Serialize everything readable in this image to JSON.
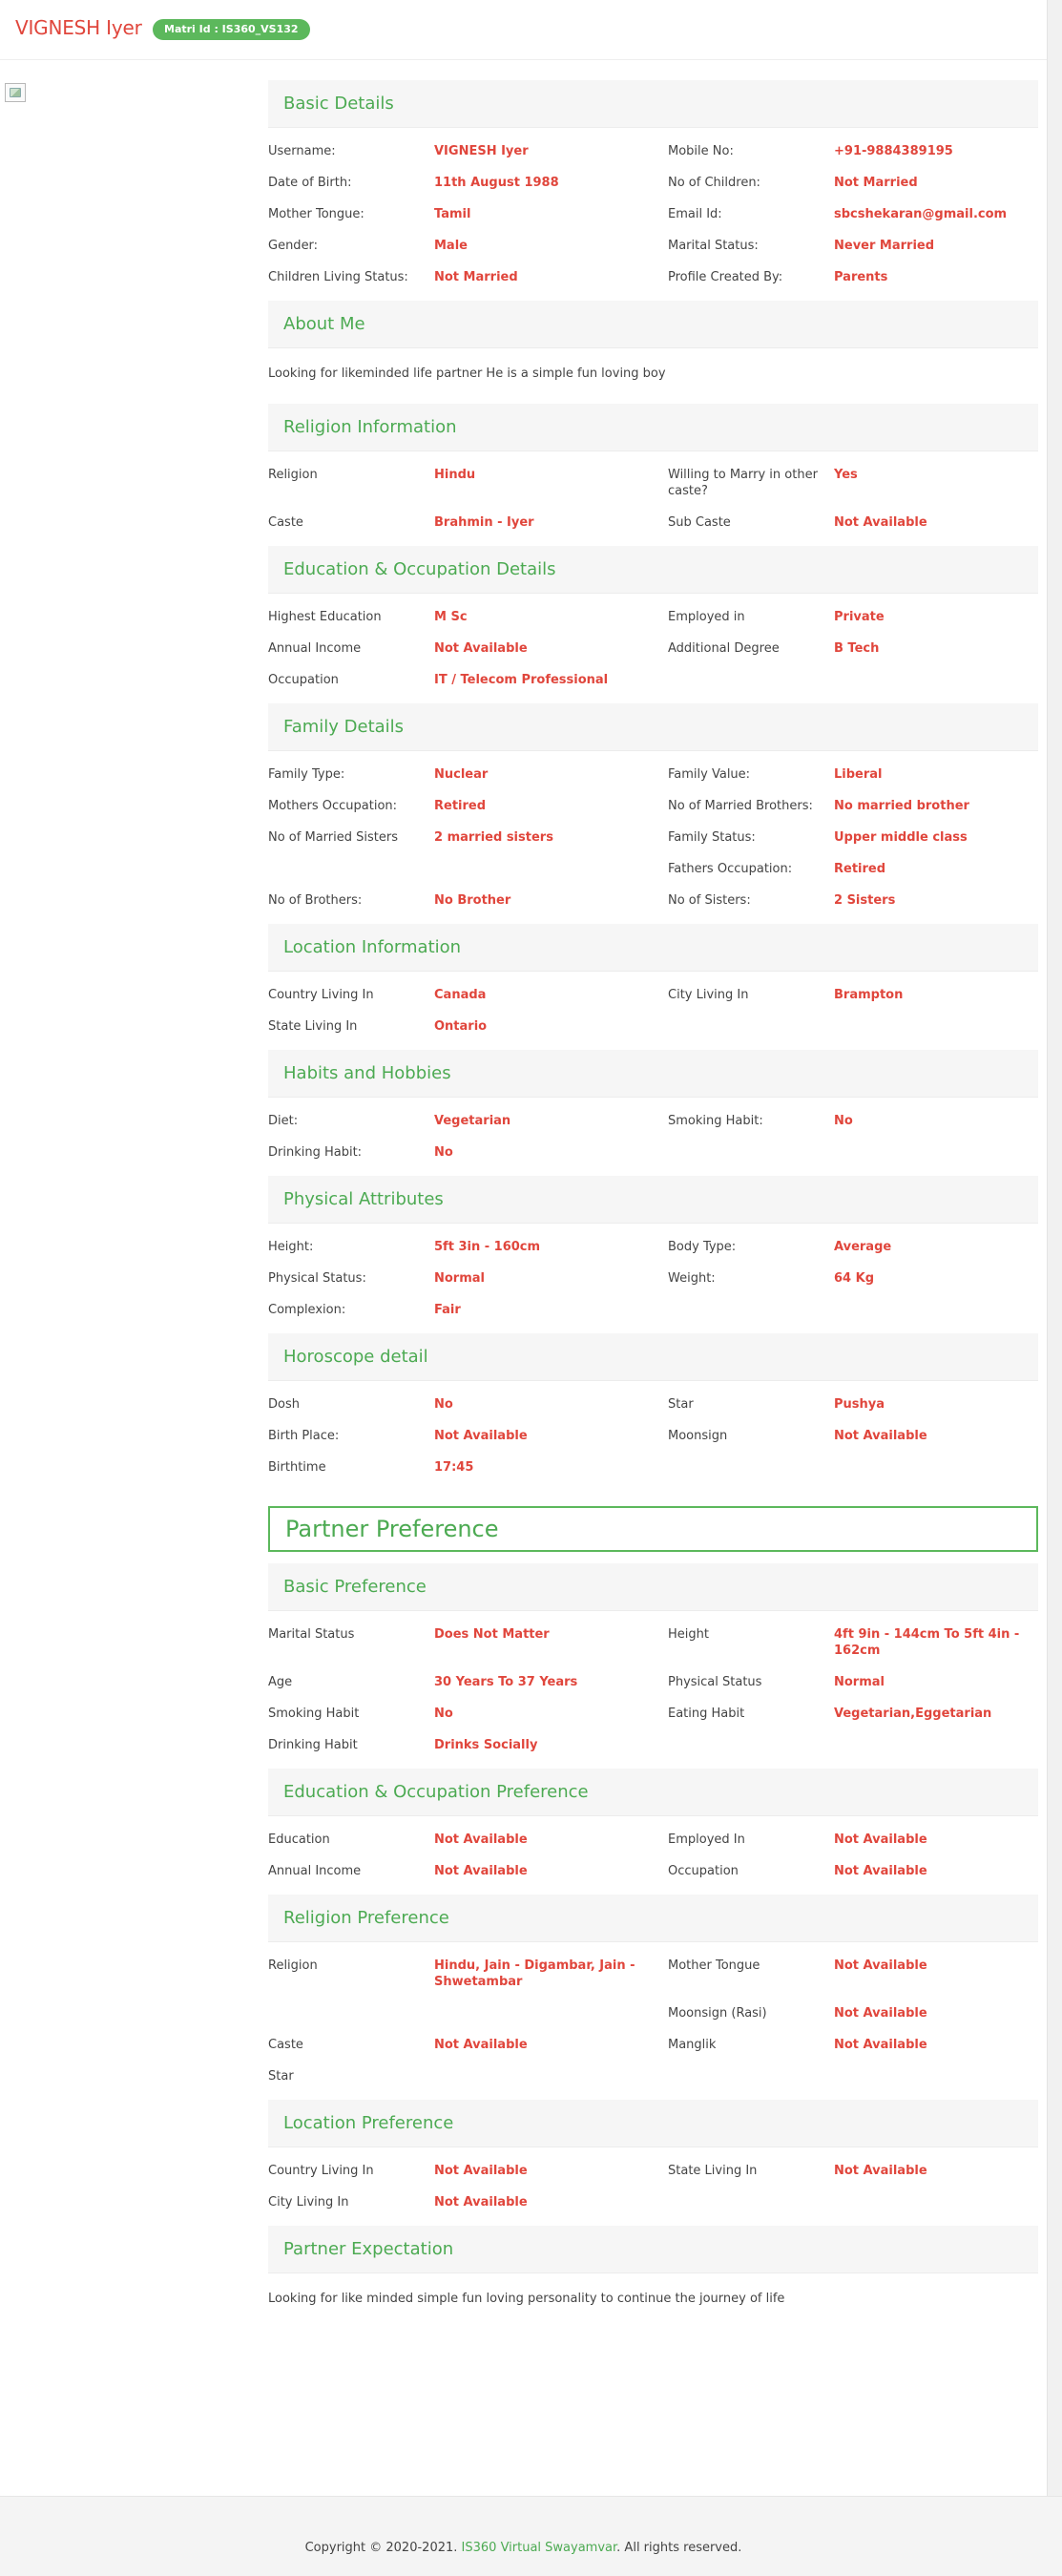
{
  "header": {
    "name": "VIGNESH Iyer",
    "matri_id": "Matri Id : IS360_VS132"
  },
  "basic_details": {
    "title": "Basic Details",
    "rows": [
      [
        {
          "label": "Username:",
          "value": "VIGNESH Iyer"
        },
        {
          "label": "Mobile No:",
          "value": "+91-9884389195"
        }
      ],
      [
        {
          "label": "Date of Birth:",
          "value": "11th August 1988"
        },
        {
          "label": "No of Children:",
          "value": "Not Married"
        }
      ],
      [
        {
          "label": "Mother Tongue:",
          "value": "Tamil"
        },
        {
          "label": "Email Id:",
          "value": "sbcshekaran@gmail.com"
        }
      ],
      [
        {
          "label": "Gender:",
          "value": "Male"
        },
        {
          "label": "Marital Status:",
          "value": "Never Married"
        }
      ],
      [
        {
          "label": "Children Living Status:",
          "value": "Not Married"
        },
        {
          "label": "Profile Created By:",
          "value": "Parents"
        }
      ]
    ]
  },
  "about_me": {
    "title": "About Me",
    "text": "Looking for likeminded life partner He is a simple fun loving boy"
  },
  "religion_info": {
    "title": "Religion Information",
    "rows": [
      [
        {
          "label": "Religion",
          "value": "Hindu"
        },
        {
          "label": "Willing to Marry in other caste?",
          "value": "Yes"
        }
      ],
      [
        {
          "label": "Caste",
          "value": "Brahmin - Iyer"
        },
        {
          "label": "Sub Caste",
          "value": "Not Available"
        }
      ]
    ]
  },
  "education": {
    "title": "Education & Occupation Details",
    "rows": [
      [
        {
          "label": "Highest Education",
          "value": "M Sc"
        },
        {
          "label": "Employed in",
          "value": "Private"
        }
      ],
      [
        {
          "label": "Annual Income",
          "value": "Not Available"
        },
        {
          "label": "Additional Degree",
          "value": "B Tech"
        }
      ],
      [
        {
          "label": "Occupation",
          "value": "IT / Telecom Professional"
        },
        {
          "label": "",
          "value": ""
        }
      ]
    ]
  },
  "family": {
    "title": "Family Details",
    "rows": [
      [
        {
          "label": "Family Type:",
          "value": "Nuclear"
        },
        {
          "label": "Family Value:",
          "value": "Liberal"
        }
      ],
      [
        {
          "label": "Mothers Occupation:",
          "value": "Retired"
        },
        {
          "label": "No of Married Brothers:",
          "value": "No married brother"
        }
      ],
      [
        {
          "label": "No of Married Sisters",
          "value": "2 married sisters"
        },
        {
          "label": "Family Status:",
          "value": "Upper middle class"
        }
      ],
      [
        {
          "label": "",
          "value": ""
        },
        {
          "label": "Fathers Occupation:",
          "value": "Retired"
        }
      ],
      [
        {
          "label": "No of Brothers:",
          "value": "No Brother"
        },
        {
          "label": "No of Sisters:",
          "value": "2 Sisters"
        }
      ]
    ]
  },
  "location": {
    "title": "Location Information",
    "rows": [
      [
        {
          "label": "Country Living In",
          "value": "Canada"
        },
        {
          "label": "City Living In",
          "value": "Brampton"
        }
      ],
      [
        {
          "label": "State Living In",
          "value": "Ontario"
        },
        {
          "label": "",
          "value": ""
        }
      ]
    ]
  },
  "habits": {
    "title": "Habits and Hobbies",
    "rows": [
      [
        {
          "label": "Diet:",
          "value": "Vegetarian"
        },
        {
          "label": "Smoking Habit:",
          "value": "No"
        }
      ],
      [
        {
          "label": "Drinking Habit:",
          "value": "No"
        },
        {
          "label": "",
          "value": ""
        }
      ]
    ]
  },
  "physical": {
    "title": "Physical Attributes",
    "rows": [
      [
        {
          "label": "Height:",
          "value": "5ft 3in - 160cm"
        },
        {
          "label": "Body Type:",
          "value": "Average"
        }
      ],
      [
        {
          "label": "Physical Status:",
          "value": "Normal"
        },
        {
          "label": "Weight:",
          "value": "64 Kg"
        }
      ],
      [
        {
          "label": "Complexion:",
          "value": "Fair"
        },
        {
          "label": "",
          "value": ""
        }
      ]
    ]
  },
  "horoscope": {
    "title": "Horoscope detail",
    "rows": [
      [
        {
          "label": "Dosh",
          "value": "No"
        },
        {
          "label": "Star",
          "value": "Pushya"
        }
      ],
      [
        {
          "label": "Birth Place:",
          "value": "Not Available"
        },
        {
          "label": "Moonsign",
          "value": "Not Available"
        }
      ],
      [
        {
          "label": "Birthtime",
          "value": "17:45"
        },
        {
          "label": "",
          "value": ""
        }
      ]
    ]
  },
  "partner_preference": {
    "title": "Partner Preference"
  },
  "basic_preference": {
    "title": "Basic Preference",
    "rows": [
      [
        {
          "label": "Marital Status",
          "value": "Does Not Matter"
        },
        {
          "label": "Height",
          "value": "4ft 9in - 144cm     To     5ft 4in - 162cm"
        }
      ],
      [
        {
          "label": "Age",
          "value": "30  Years     To     37  Years"
        },
        {
          "label": "Physical Status",
          "value": "Normal"
        }
      ],
      [
        {
          "label": "Smoking Habit",
          "value": "No"
        },
        {
          "label": "Eating Habit",
          "value": "Vegetarian,Eggetarian"
        }
      ],
      [
        {
          "label": "Drinking Habit",
          "value": "Drinks Socially"
        },
        {
          "label": "",
          "value": ""
        }
      ]
    ]
  },
  "education_preference": {
    "title": "Education & Occupation Preference",
    "rows": [
      [
        {
          "label": "Education",
          "value": "Not Available"
        },
        {
          "label": "Employed In",
          "value": "Not Available"
        }
      ],
      [
        {
          "label": "Annual Income",
          "value": "Not Available"
        },
        {
          "label": "Occupation",
          "value": "Not Available"
        }
      ]
    ]
  },
  "religion_preference": {
    "title": "Religion Preference",
    "rows": [
      [
        {
          "label": "Religion",
          "value": "Hindu, Jain - Digambar, Jain - Shwetambar"
        },
        {
          "label": "Mother Tongue",
          "value": "Not Available"
        }
      ],
      [
        {
          "label": "",
          "value": ""
        },
        {
          "label": "Moonsign (Rasi)",
          "value": "Not Available"
        }
      ],
      [
        {
          "label": "Caste",
          "value": "Not Available"
        },
        {
          "label": "Manglik",
          "value": "Not Available"
        }
      ],
      [
        {
          "label": "Star",
          "value": ""
        },
        {
          "label": "",
          "value": ""
        }
      ]
    ]
  },
  "location_preference": {
    "title": "Location Preference",
    "rows": [
      [
        {
          "label": "Country Living In",
          "value": "Not Available"
        },
        {
          "label": "State Living In",
          "value": "Not Available"
        }
      ],
      [
        {
          "label": "City Living In",
          "value": "Not Available"
        },
        {
          "label": "",
          "value": ""
        }
      ]
    ]
  },
  "partner_expectation": {
    "title": "Partner Expectation",
    "text": "Looking for like minded simple fun loving personality to continue the journey of life"
  },
  "footer": {
    "prefix": "Copyright © 2020-2021. ",
    "link": "IS360 Virtual Swayamvar",
    "suffix": ". All rights reserved."
  },
  "colors": {
    "accent_green": "#4caa52",
    "value_red": "#e0463c"
  }
}
